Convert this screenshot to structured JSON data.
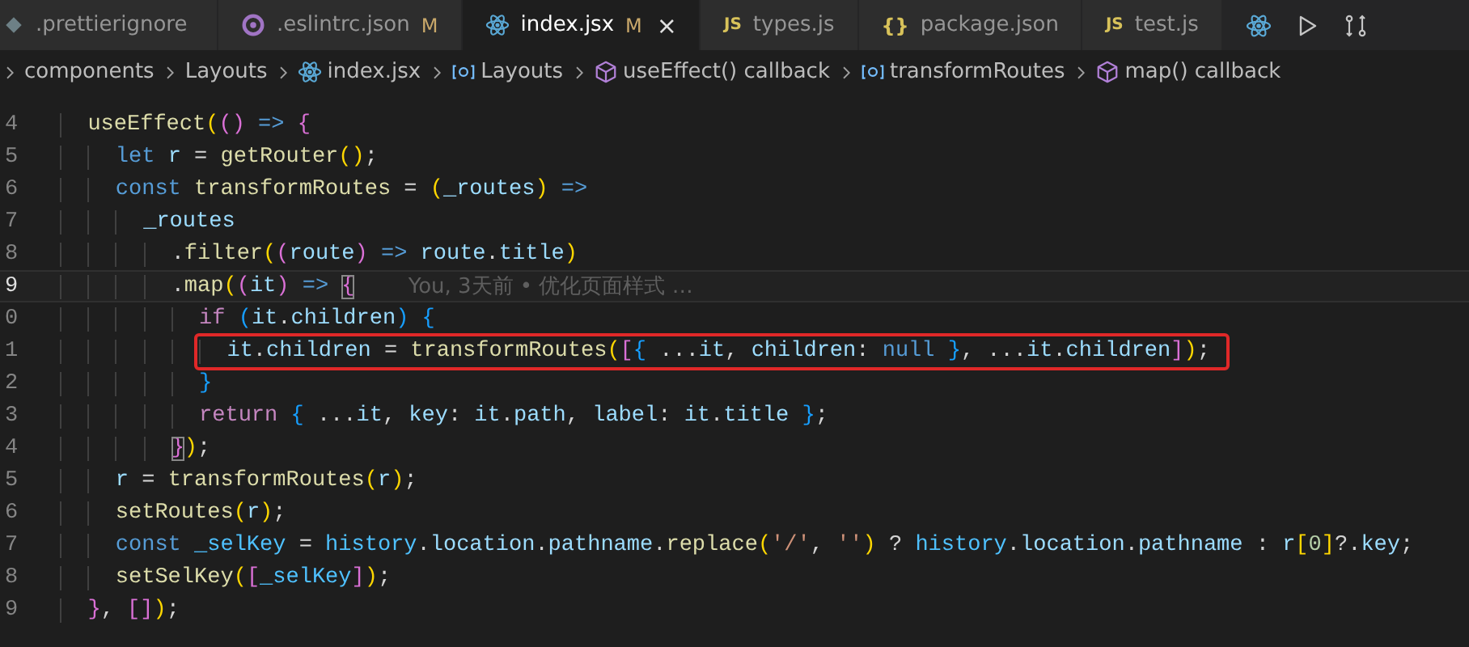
{
  "tabs": [
    {
      "label": ".prettierignore",
      "icon": {
        "kind": "diamond"
      },
      "selected": false
    },
    {
      "label": ".eslintrc.json",
      "icon": {
        "kind": "eslint"
      },
      "badge": "M",
      "selected": false
    },
    {
      "label": "index.jsx",
      "icon": {
        "kind": "react"
      },
      "badge": "M",
      "close": "×",
      "selected": true
    },
    {
      "label": "types.js",
      "icon": {
        "kind": "text",
        "text": "JS"
      },
      "selected": false
    },
    {
      "label": "package.json",
      "icon": {
        "kind": "text",
        "text": "{}"
      },
      "selected": false
    },
    {
      "label": "test.js",
      "icon": {
        "kind": "text",
        "text": "JS"
      },
      "selected": false
    }
  ],
  "breadcrumbs": [
    {
      "label": "components",
      "kind": "folder"
    },
    {
      "label": "Layouts",
      "kind": "folder"
    },
    {
      "label": "index.jsx",
      "kind": "react"
    },
    {
      "label": "Layouts",
      "kind": "variable"
    },
    {
      "label": "useEffect() callback",
      "kind": "method"
    },
    {
      "label": "transformRoutes",
      "kind": "variable"
    },
    {
      "label": "map() callback",
      "kind": "method"
    }
  ],
  "editor": {
    "lines": [
      {
        "number": "4",
        "current": false,
        "boxed": false,
        "tokens": [
          {
            "text": "  useEffect",
            "color": "#dcdcaa"
          },
          {
            "text": "(",
            "color": "#ffd700"
          },
          {
            "text": "()",
            "color": "#da70d6"
          },
          {
            "text": " => ",
            "color": "#569cd6"
          },
          {
            "text": "{",
            "color": "#da70d6"
          }
        ]
      },
      {
        "number": "5",
        "current": false,
        "boxed": false,
        "tokens": [
          {
            "text": "    let",
            "color": "#569cd6"
          },
          {
            "text": " r",
            "color": "#9cdcfe"
          },
          {
            "text": " = ",
            "color": "#d4d4d4"
          },
          {
            "text": "getRouter",
            "color": "#dcdcaa"
          },
          {
            "text": "()",
            "color": "#ffd700"
          },
          {
            "text": ";",
            "color": "#d4d4d4"
          }
        ]
      },
      {
        "number": "6",
        "current": false,
        "boxed": false,
        "tokens": [
          {
            "text": "    const",
            "color": "#569cd6"
          },
          {
            "text": " transformRoutes",
            "color": "#dcdcaa"
          },
          {
            "text": " = ",
            "color": "#d4d4d4"
          },
          {
            "text": "(",
            "color": "#ffd700"
          },
          {
            "text": "_routes",
            "color": "#9cdcfe"
          },
          {
            "text": ")",
            "color": "#ffd700"
          },
          {
            "text": " =>",
            "color": "#569cd6"
          }
        ]
      },
      {
        "number": "7",
        "current": false,
        "boxed": false,
        "tokens": [
          {
            "text": "      _routes",
            "color": "#9cdcfe"
          }
        ]
      },
      {
        "number": "8",
        "current": false,
        "boxed": false,
        "tokens": [
          {
            "text": "        .",
            "color": "#d4d4d4"
          },
          {
            "text": "filter",
            "color": "#dcdcaa"
          },
          {
            "text": "(",
            "color": "#ffd700"
          },
          {
            "text": "(",
            "color": "#da70d6"
          },
          {
            "text": "route",
            "color": "#9cdcfe"
          },
          {
            "text": ")",
            "color": "#da70d6"
          },
          {
            "text": " => ",
            "color": "#569cd6"
          },
          {
            "text": "route",
            "color": "#9cdcfe"
          },
          {
            "text": ".",
            "color": "#d4d4d4"
          },
          {
            "text": "title",
            "color": "#9cdcfe"
          },
          {
            "text": ")",
            "color": "#ffd700"
          }
        ]
      },
      {
        "number": "9",
        "current": true,
        "boxed": false,
        "blame": "You, 3天前 • 优化页面样式 …",
        "tokens": [
          {
            "text": "        .",
            "color": "#d4d4d4"
          },
          {
            "text": "map",
            "color": "#dcdcaa"
          },
          {
            "text": "(",
            "color": "#ffd700"
          },
          {
            "text": "(",
            "color": "#da70d6"
          },
          {
            "text": "it",
            "color": "#9cdcfe"
          },
          {
            "text": ")",
            "color": "#da70d6"
          },
          {
            "text": " => ",
            "color": "#569cd6"
          },
          {
            "text": "{",
            "color": "#da70d6",
            "match": true
          }
        ]
      },
      {
        "number": "0",
        "current": false,
        "boxed": false,
        "tokens": [
          {
            "text": "          if ",
            "color": "#c586c0"
          },
          {
            "text": "(",
            "color": "#179fff"
          },
          {
            "text": "it",
            "color": "#9cdcfe"
          },
          {
            "text": ".",
            "color": "#d4d4d4"
          },
          {
            "text": "children",
            "color": "#9cdcfe"
          },
          {
            "text": ")",
            "color": "#179fff"
          },
          {
            "text": " {",
            "color": "#179fff"
          }
        ]
      },
      {
        "number": "1",
        "current": false,
        "boxed": true,
        "tokens": [
          {
            "text": "            it",
            "color": "#9cdcfe"
          },
          {
            "text": ".",
            "color": "#d4d4d4"
          },
          {
            "text": "children",
            "color": "#9cdcfe"
          },
          {
            "text": " = ",
            "color": "#d4d4d4"
          },
          {
            "text": "transformRoutes",
            "color": "#dcdcaa"
          },
          {
            "text": "(",
            "color": "#ffd700"
          },
          {
            "text": "[",
            "color": "#da70d6"
          },
          {
            "text": "{",
            "color": "#179fff"
          },
          {
            "text": " ...",
            "color": "#d4d4d4"
          },
          {
            "text": "it",
            "color": "#9cdcfe"
          },
          {
            "text": ", ",
            "color": "#d4d4d4"
          },
          {
            "text": "children",
            "color": "#9cdcfe"
          },
          {
            "text": ": ",
            "color": "#d4d4d4"
          },
          {
            "text": "null ",
            "color": "#569cd6"
          },
          {
            "text": "}",
            "color": "#179fff"
          },
          {
            "text": ", ...",
            "color": "#d4d4d4"
          },
          {
            "text": "it",
            "color": "#9cdcfe"
          },
          {
            "text": ".",
            "color": "#d4d4d4"
          },
          {
            "text": "children",
            "color": "#9cdcfe"
          },
          {
            "text": "]",
            "color": "#da70d6"
          },
          {
            "text": ")",
            "color": "#ffd700"
          },
          {
            "text": ";",
            "color": "#d4d4d4"
          }
        ]
      },
      {
        "number": "2",
        "current": false,
        "boxed": false,
        "tokens": [
          {
            "text": "          }",
            "color": "#179fff"
          }
        ]
      },
      {
        "number": "3",
        "current": false,
        "boxed": false,
        "tokens": [
          {
            "text": "          return ",
            "color": "#c586c0"
          },
          {
            "text": "{",
            "color": "#179fff"
          },
          {
            "text": " ...",
            "color": "#d4d4d4"
          },
          {
            "text": "it",
            "color": "#9cdcfe"
          },
          {
            "text": ", ",
            "color": "#d4d4d4"
          },
          {
            "text": "key",
            "color": "#9cdcfe"
          },
          {
            "text": ": ",
            "color": "#d4d4d4"
          },
          {
            "text": "it",
            "color": "#9cdcfe"
          },
          {
            "text": ".",
            "color": "#d4d4d4"
          },
          {
            "text": "path",
            "color": "#9cdcfe"
          },
          {
            "text": ", ",
            "color": "#d4d4d4"
          },
          {
            "text": "label",
            "color": "#9cdcfe"
          },
          {
            "text": ": ",
            "color": "#d4d4d4"
          },
          {
            "text": "it",
            "color": "#9cdcfe"
          },
          {
            "text": ".",
            "color": "#d4d4d4"
          },
          {
            "text": "title ",
            "color": "#9cdcfe"
          },
          {
            "text": "}",
            "color": "#179fff"
          },
          {
            "text": ";",
            "color": "#d4d4d4"
          }
        ]
      },
      {
        "number": "4",
        "current": false,
        "boxed": false,
        "tokens": [
          {
            "text": "        }",
            "color": "#da70d6",
            "match": true
          },
          {
            "text": ")",
            "color": "#ffd700"
          },
          {
            "text": ";",
            "color": "#d4d4d4"
          }
        ]
      },
      {
        "number": "5",
        "current": false,
        "boxed": false,
        "tokens": [
          {
            "text": "    r",
            "color": "#9cdcfe"
          },
          {
            "text": " = ",
            "color": "#d4d4d4"
          },
          {
            "text": "transformRoutes",
            "color": "#dcdcaa"
          },
          {
            "text": "(",
            "color": "#ffd700"
          },
          {
            "text": "r",
            "color": "#9cdcfe"
          },
          {
            "text": ")",
            "color": "#ffd700"
          },
          {
            "text": ";",
            "color": "#d4d4d4"
          }
        ]
      },
      {
        "number": "6",
        "current": false,
        "boxed": false,
        "tokens": [
          {
            "text": "    setRoutes",
            "color": "#dcdcaa"
          },
          {
            "text": "(",
            "color": "#ffd700"
          },
          {
            "text": "r",
            "color": "#9cdcfe"
          },
          {
            "text": ")",
            "color": "#ffd700"
          },
          {
            "text": ";",
            "color": "#d4d4d4"
          }
        ]
      },
      {
        "number": "7",
        "current": false,
        "boxed": false,
        "tokens": [
          {
            "text": "    const",
            "color": "#569cd6"
          },
          {
            "text": " _selKey",
            "color": "#4fc1ff"
          },
          {
            "text": " = ",
            "color": "#d4d4d4"
          },
          {
            "text": "history",
            "color": "#4fc1ff"
          },
          {
            "text": ".",
            "color": "#d4d4d4"
          },
          {
            "text": "location",
            "color": "#9cdcfe"
          },
          {
            "text": ".",
            "color": "#d4d4d4"
          },
          {
            "text": "pathname",
            "color": "#9cdcfe"
          },
          {
            "text": ".",
            "color": "#d4d4d4"
          },
          {
            "text": "replace",
            "color": "#dcdcaa"
          },
          {
            "text": "(",
            "color": "#ffd700"
          },
          {
            "text": "'/'",
            "color": "#ce9178"
          },
          {
            "text": ", ",
            "color": "#d4d4d4"
          },
          {
            "text": "''",
            "color": "#ce9178"
          },
          {
            "text": ")",
            "color": "#ffd700"
          },
          {
            "text": " ? ",
            "color": "#d4d4d4"
          },
          {
            "text": "history",
            "color": "#4fc1ff"
          },
          {
            "text": ".",
            "color": "#d4d4d4"
          },
          {
            "text": "location",
            "color": "#9cdcfe"
          },
          {
            "text": ".",
            "color": "#d4d4d4"
          },
          {
            "text": "pathname",
            "color": "#9cdcfe"
          },
          {
            "text": " : ",
            "color": "#d4d4d4"
          },
          {
            "text": "r",
            "color": "#9cdcfe"
          },
          {
            "text": "[",
            "color": "#ffd700"
          },
          {
            "text": "0",
            "color": "#b5cea8"
          },
          {
            "text": "]",
            "color": "#ffd700"
          },
          {
            "text": "?.",
            "color": "#d4d4d4"
          },
          {
            "text": "key",
            "color": "#9cdcfe"
          },
          {
            "text": ";",
            "color": "#d4d4d4"
          }
        ]
      },
      {
        "number": "8",
        "current": false,
        "boxed": false,
        "tokens": [
          {
            "text": "    setSelKey",
            "color": "#dcdcaa"
          },
          {
            "text": "(",
            "color": "#ffd700"
          },
          {
            "text": "[",
            "color": "#da70d6"
          },
          {
            "text": "_selKey",
            "color": "#4fc1ff"
          },
          {
            "text": "]",
            "color": "#da70d6"
          },
          {
            "text": ")",
            "color": "#ffd700"
          },
          {
            "text": ";",
            "color": "#d4d4d4"
          }
        ]
      },
      {
        "number": "9",
        "current": false,
        "boxed": false,
        "tokens": [
          {
            "text": "  }",
            "color": "#da70d6"
          },
          {
            "text": ", ",
            "color": "#d4d4d4"
          },
          {
            "text": "[]",
            "color": "#da70d6"
          },
          {
            "text": ")",
            "color": "#ffd700"
          },
          {
            "text": ";",
            "color": "#d4d4d4"
          }
        ]
      }
    ]
  }
}
